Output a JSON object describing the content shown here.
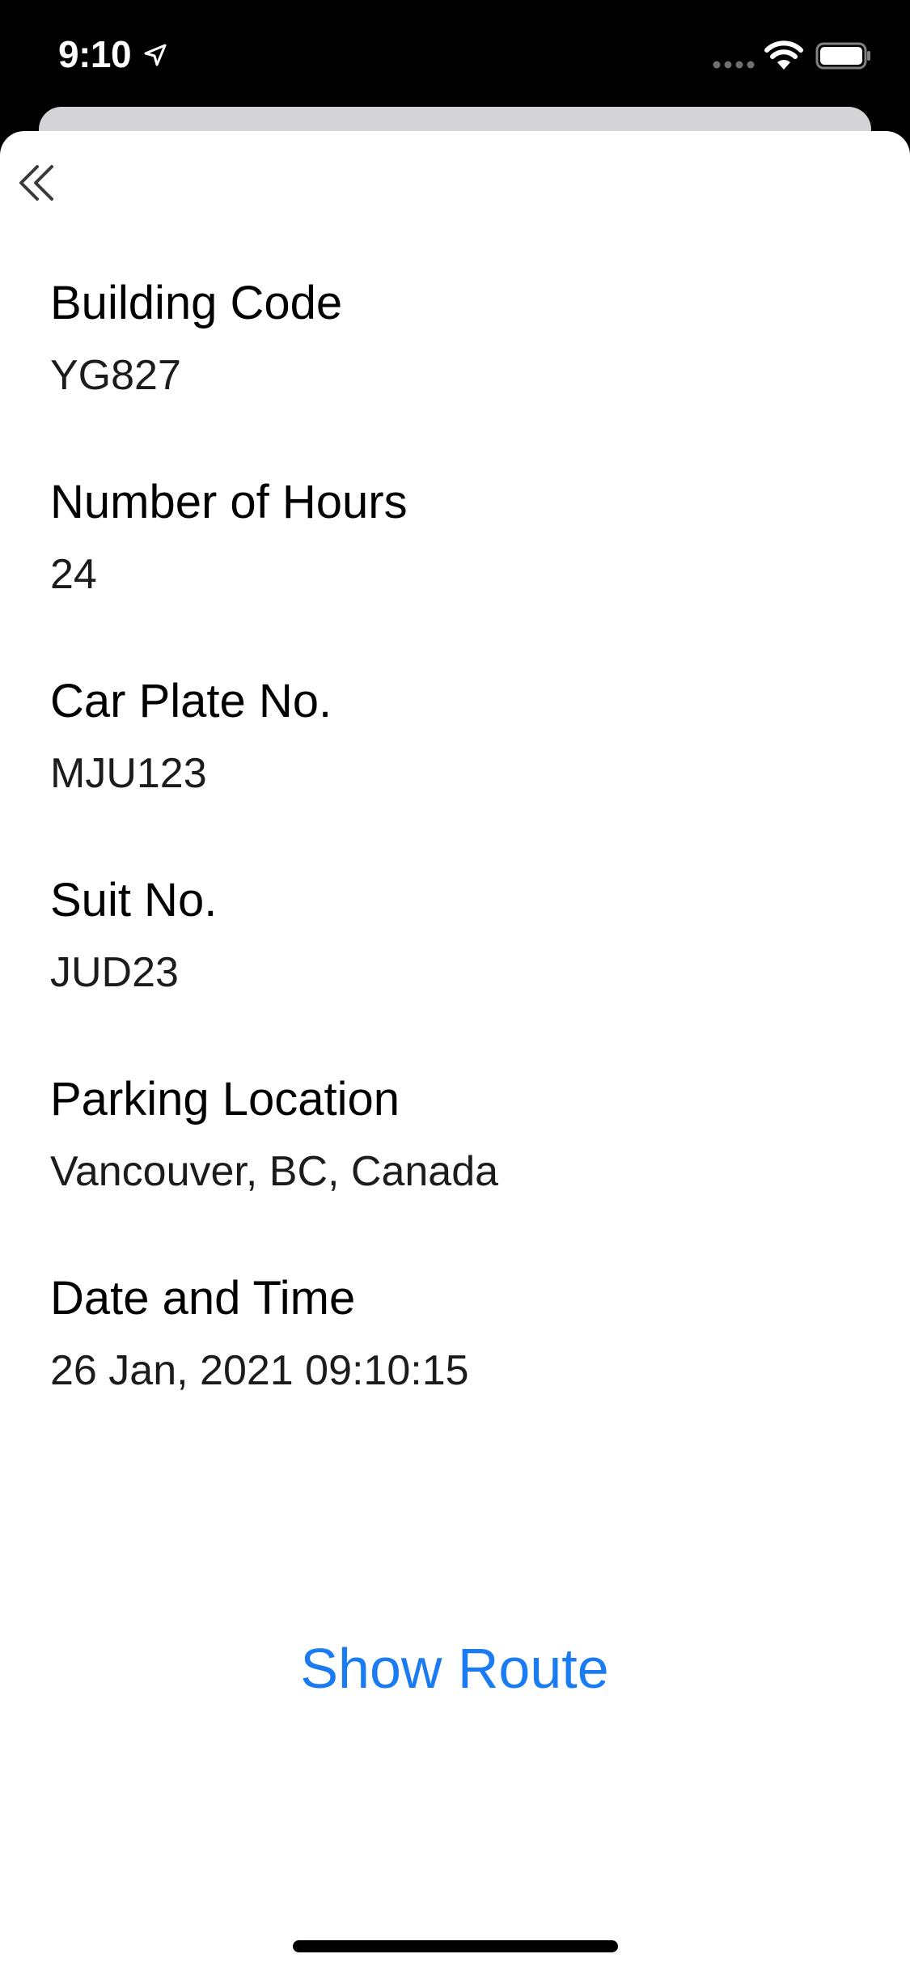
{
  "status_bar": {
    "time": "9:10"
  },
  "navigation": {
    "back_icon": "double-chevron-left-icon"
  },
  "details": [
    {
      "label": "Building Code",
      "value": "YG827"
    },
    {
      "label": "Number of Hours",
      "value": "24"
    },
    {
      "label": "Car Plate No.",
      "value": "MJU123"
    },
    {
      "label": "Suit No.",
      "value": "JUD23"
    },
    {
      "label": "Parking Location",
      "value": "Vancouver, BC, Canada"
    },
    {
      "label": "Date and Time",
      "value": "26 Jan, 2021 09:10:15"
    }
  ],
  "actions": {
    "show_route_label": "Show Route"
  },
  "colors": {
    "accent": "#1b7cf2",
    "background": "#ffffff",
    "status_bar": "#000000"
  }
}
